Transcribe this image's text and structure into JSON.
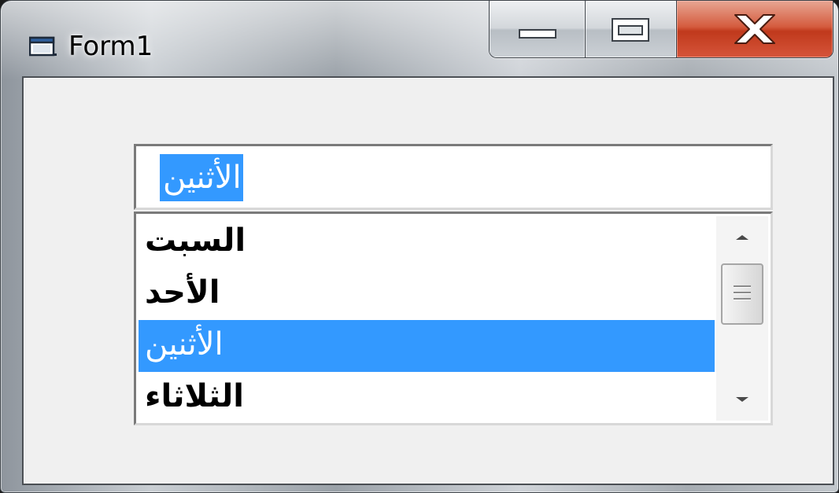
{
  "window": {
    "title": "Form1",
    "icon": "form-window-icon",
    "controls": {
      "minimize_icon": "minimize-icon",
      "maximize_icon": "maximize-icon",
      "close_icon": "close-icon"
    }
  },
  "combo": {
    "text": "الأثنين"
  },
  "listbox": {
    "items": [
      {
        "label": "السبت",
        "selected": false
      },
      {
        "label": "الأحد",
        "selected": false
      },
      {
        "label": "الأثنين",
        "selected": true
      },
      {
        "label": "الثلاثاء",
        "selected": false
      }
    ]
  },
  "colors": {
    "selection": "#3399ff",
    "selection_text": "#ffffff",
    "close_button": "#c8472a",
    "client_background": "#f0f0f0"
  }
}
